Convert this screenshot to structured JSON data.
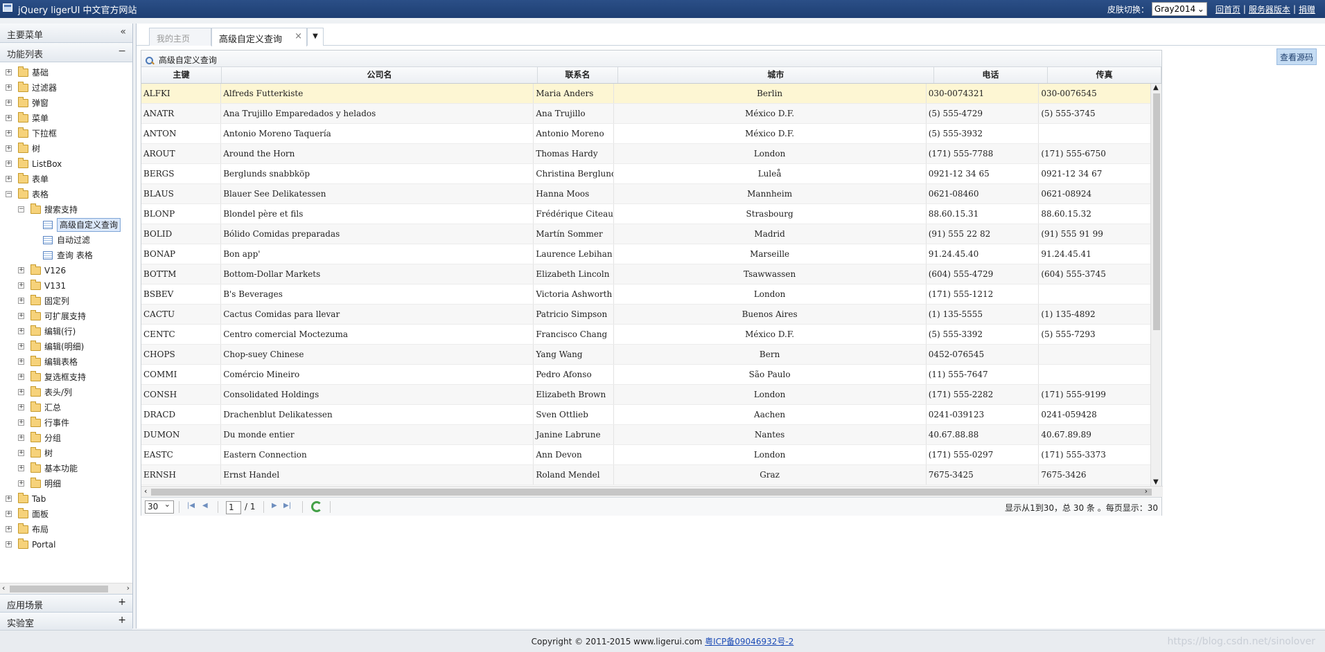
{
  "header": {
    "title": "jQuery ligerUI 中文官方网站",
    "skin_label": "皮肤切换：",
    "skin_value": "Gray2014",
    "links": [
      "回首页",
      "服务器版本",
      "捐赠"
    ]
  },
  "sidebar": {
    "title": "主要菜单",
    "section_title": "功能列表",
    "tree": [
      {
        "label": "基础",
        "level": 0,
        "expanded": false
      },
      {
        "label": "过滤器",
        "level": 0,
        "expanded": false
      },
      {
        "label": "弹窗",
        "level": 0,
        "expanded": false
      },
      {
        "label": "菜单",
        "level": 0,
        "expanded": false
      },
      {
        "label": "下拉框",
        "level": 0,
        "expanded": false
      },
      {
        "label": "树",
        "level": 0,
        "expanded": false
      },
      {
        "label": "ListBox",
        "level": 0,
        "expanded": false
      },
      {
        "label": "表单",
        "level": 0,
        "expanded": false
      },
      {
        "label": "表格",
        "level": 0,
        "expanded": true
      },
      {
        "label": "搜索支持",
        "level": 1,
        "expanded": true
      },
      {
        "label": "高级自定义查询",
        "level": 2,
        "leaf": true,
        "selected": true
      },
      {
        "label": "自动过滤",
        "level": 2,
        "leaf": true
      },
      {
        "label": "查询 表格",
        "level": 2,
        "leaf": true
      },
      {
        "label": "V126",
        "level": 1,
        "expanded": false
      },
      {
        "label": "V131",
        "level": 1,
        "expanded": false
      },
      {
        "label": "固定列",
        "level": 1,
        "expanded": false
      },
      {
        "label": "可扩展支持",
        "level": 1,
        "expanded": false
      },
      {
        "label": "编辑(行)",
        "level": 1,
        "expanded": false
      },
      {
        "label": "编辑(明细)",
        "level": 1,
        "expanded": false
      },
      {
        "label": "编辑表格",
        "level": 1,
        "expanded": false
      },
      {
        "label": "复选框支持",
        "level": 1,
        "expanded": false
      },
      {
        "label": "表头/列",
        "level": 1,
        "expanded": false
      },
      {
        "label": "汇总",
        "level": 1,
        "expanded": false
      },
      {
        "label": "行事件",
        "level": 1,
        "expanded": false
      },
      {
        "label": "分组",
        "level": 1,
        "expanded": false
      },
      {
        "label": "树",
        "level": 1,
        "expanded": false
      },
      {
        "label": "基本功能",
        "level": 1,
        "expanded": false
      },
      {
        "label": "明细",
        "level": 1,
        "expanded": false
      },
      {
        "label": "Tab",
        "level": 0,
        "expanded": false
      },
      {
        "label": "面板",
        "level": 0,
        "expanded": false
      },
      {
        "label": "布局",
        "level": 0,
        "expanded": false
      },
      {
        "label": "Portal",
        "level": 0,
        "expanded": false
      }
    ],
    "footer_sections": [
      "应用场景",
      "实验室"
    ]
  },
  "tabs": [
    {
      "label": "我的主页",
      "active": false
    },
    {
      "label": "高级自定义查询",
      "active": true
    }
  ],
  "view_source": "查看源码",
  "grid": {
    "title": "高级自定义查询",
    "columns": [
      "主键",
      "公司名",
      "联系名",
      "城市",
      "电话",
      "传真"
    ],
    "rows": [
      [
        "ALFKI",
        "Alfreds Futterkiste",
        "Maria Anders",
        "Berlin",
        "030-0074321",
        "030-0076545"
      ],
      [
        "ANATR",
        "Ana Trujillo Emparedados y helados",
        "Ana Trujillo",
        "México D.F.",
        "(5) 555-4729",
        "(5) 555-3745"
      ],
      [
        "ANTON",
        "Antonio Moreno Taquería",
        "Antonio Moreno",
        "México D.F.",
        "(5) 555-3932",
        ""
      ],
      [
        "AROUT",
        "Around the Horn",
        "Thomas Hardy",
        "London",
        "(171) 555-7788",
        "(171) 555-6750"
      ],
      [
        "BERGS",
        "Berglunds snabbköp",
        "Christina Berglund",
        "Luleå",
        "0921-12 34 65",
        "0921-12 34 67"
      ],
      [
        "BLAUS",
        "Blauer See Delikatessen",
        "Hanna Moos",
        "Mannheim",
        "0621-08460",
        "0621-08924"
      ],
      [
        "BLONP",
        "Blondel père et fils",
        "Frédérique Citeaux",
        "Strasbourg",
        "88.60.15.31",
        "88.60.15.32"
      ],
      [
        "BOLID",
        "Bólido Comidas preparadas",
        "Martín Sommer",
        "Madrid",
        "(91) 555 22 82",
        "(91) 555 91 99"
      ],
      [
        "BONAP",
        "Bon app'",
        "Laurence Lebihan",
        "Marseille",
        "91.24.45.40",
        "91.24.45.41"
      ],
      [
        "BOTTM",
        "Bottom-Dollar Markets",
        "Elizabeth Lincoln",
        "Tsawwassen",
        "(604) 555-4729",
        "(604) 555-3745"
      ],
      [
        "BSBEV",
        "B's Beverages",
        "Victoria Ashworth",
        "London",
        "(171) 555-1212",
        ""
      ],
      [
        "CACTU",
        "Cactus Comidas para llevar",
        "Patricio Simpson",
        "Buenos Aires",
        "(1) 135-5555",
        "(1) 135-4892"
      ],
      [
        "CENTC",
        "Centro comercial Moctezuma",
        "Francisco Chang",
        "México D.F.",
        "(5) 555-3392",
        "(5) 555-7293"
      ],
      [
        "CHOPS",
        "Chop-suey Chinese",
        "Yang Wang",
        "Bern",
        "0452-076545",
        ""
      ],
      [
        "COMMI",
        "Comércio Mineiro",
        "Pedro Afonso",
        "São Paulo",
        "(11) 555-7647",
        ""
      ],
      [
        "CONSH",
        "Consolidated Holdings",
        "Elizabeth Brown",
        "London",
        "(171) 555-2282",
        "(171) 555-9199"
      ],
      [
        "DRACD",
        "Drachenblut Delikatessen",
        "Sven Ottlieb",
        "Aachen",
        "0241-039123",
        "0241-059428"
      ],
      [
        "DUMON",
        "Du monde entier",
        "Janine Labrune",
        "Nantes",
        "40.67.88.88",
        "40.67.89.89"
      ],
      [
        "EASTC",
        "Eastern Connection",
        "Ann Devon",
        "London",
        "(171) 555-0297",
        "(171) 555-3373"
      ],
      [
        "ERNSH",
        "Ernst Handel",
        "Roland Mendel",
        "Graz",
        "7675-3425",
        "7675-3426"
      ]
    ],
    "pager": {
      "page_size": "30",
      "page": "1",
      "total_pages": "/ 1",
      "info": "显示从1到30，总 30 条 。每页显示：30"
    }
  },
  "footer": {
    "copyright": "Copyright © 2011-2015 www.ligerui.com",
    "icp": "粤ICP备09046932号-2",
    "watermark": "https://blog.csdn.net/sinolover"
  }
}
